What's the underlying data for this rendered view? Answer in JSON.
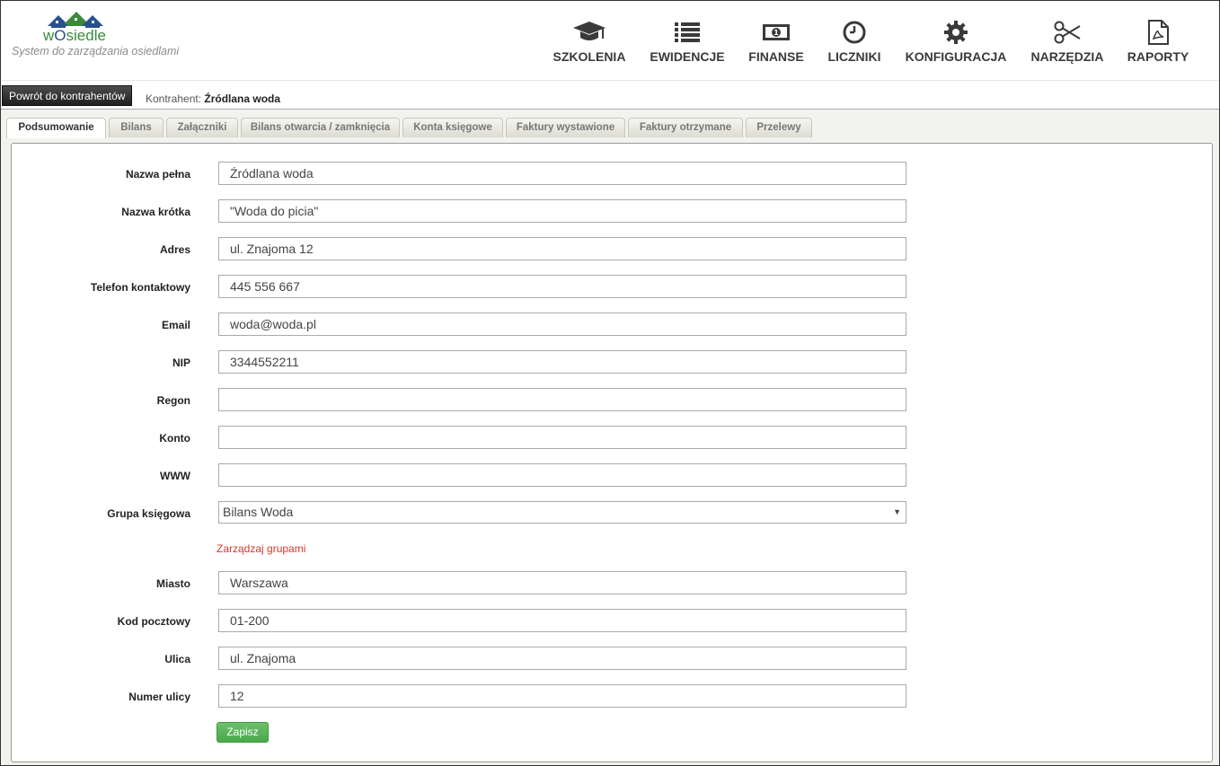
{
  "app": {
    "logo_text_prefix": "w",
    "logo_text_o": "O",
    "logo_text_rest": "siedle",
    "tagline": "System do zarządzania osiedlami"
  },
  "nav": [
    {
      "label": "SZKOLENIA",
      "icon": "graduation-cap-icon"
    },
    {
      "label": "EWIDENCJE",
      "icon": "list-icon"
    },
    {
      "label": "FINANSE",
      "icon": "banknote-icon"
    },
    {
      "label": "LICZNIKI",
      "icon": "clock-icon"
    },
    {
      "label": "KONFIGURACJA",
      "icon": "gear-icon"
    },
    {
      "label": "NARZĘDZIA",
      "icon": "scissors-icon"
    },
    {
      "label": "RAPORTY",
      "icon": "pdf-file-icon"
    }
  ],
  "subbar": {
    "back_label": "Powrót do kontrahentów",
    "contractor_label": "Kontrahent:",
    "contractor_name": "Źródlana woda"
  },
  "tabs": [
    {
      "label": "Podsumowanie",
      "active": true
    },
    {
      "label": "Bilans"
    },
    {
      "label": "Załączniki"
    },
    {
      "label": "Bilans otwarcia / zamknięcia"
    },
    {
      "label": "Konta księgowe"
    },
    {
      "label": "Faktury wystawione"
    },
    {
      "label": "Faktury otrzymane"
    },
    {
      "label": "Przelewy"
    }
  ],
  "form": {
    "full_name": {
      "label": "Nazwa pełna",
      "value": "Źródlana woda"
    },
    "short_name": {
      "label": "Nazwa krótka",
      "value": "\"Woda do picia\""
    },
    "address": {
      "label": "Adres",
      "value": "ul. Znajoma 12"
    },
    "phone": {
      "label": "Telefon kontaktowy",
      "value": "445 556 667"
    },
    "email": {
      "label": "Email",
      "value": "woda@woda.pl"
    },
    "nip": {
      "label": "NIP",
      "value": "3344552211"
    },
    "regon": {
      "label": "Regon",
      "value": ""
    },
    "account": {
      "label": "Konto",
      "value": ""
    },
    "www": {
      "label": "WWW",
      "value": ""
    },
    "group": {
      "label": "Grupa księgowa",
      "value": "Bilans Woda"
    },
    "manage_groups": "Zarządzaj grupami",
    "city": {
      "label": "Miasto",
      "value": "Warszawa"
    },
    "postal_code": {
      "label": "Kod pocztowy",
      "value": "01-200"
    },
    "street": {
      "label": "Ulica",
      "value": "ul. Znajoma"
    },
    "street_number": {
      "label": "Numer ulicy",
      "value": "12"
    },
    "save_label": "Zapisz"
  },
  "colors": {
    "accent_green": "#4aa84a",
    "link_red": "#d43a2a",
    "logo_green": "#3a8a3a",
    "logo_blue": "#2a4f8f"
  }
}
